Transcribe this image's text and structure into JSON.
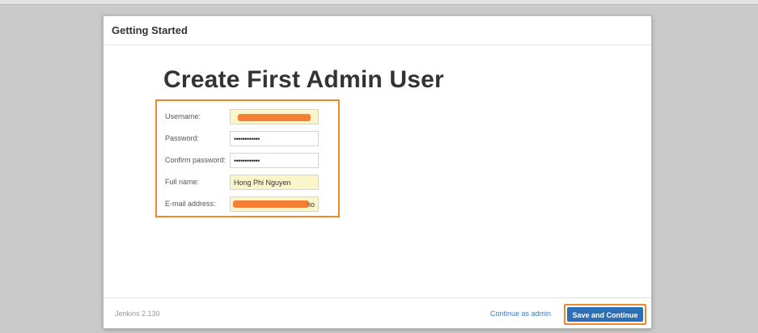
{
  "dialog": {
    "header_title": "Getting Started",
    "heading": "Create First Admin User"
  },
  "form": {
    "fields": [
      {
        "label": "Username:",
        "value": ""
      },
      {
        "label": "Password:",
        "value": "••••••••••••"
      },
      {
        "label": "Confirm password:",
        "value": "••••••••••••"
      },
      {
        "label": "Full name:",
        "value": "Hong Phi Nguyen"
      },
      {
        "label": "E-mail address:",
        "value": "ho"
      }
    ]
  },
  "footer": {
    "version": "Jenkins 2.130",
    "continue_as_admin": "Continue as admin",
    "save_continue": "Save and Continue"
  },
  "colors": {
    "accent_outline": "#f0872a",
    "primary_button": "#2d6fb5",
    "link": "#3a7cc2",
    "autofill": "#fbf6c9"
  }
}
